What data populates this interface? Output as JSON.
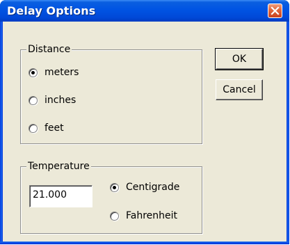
{
  "window": {
    "title": "Delay Options"
  },
  "distance": {
    "legend": "Distance",
    "options": [
      {
        "label": "meters",
        "checked": true
      },
      {
        "label": "inches",
        "checked": false
      },
      {
        "label": "feet",
        "checked": false
      }
    ]
  },
  "temperature": {
    "legend": "Temperature",
    "value": "21.000",
    "options": [
      {
        "label": "Centigrade",
        "checked": true
      },
      {
        "label": "Fahrenheit",
        "checked": false
      }
    ]
  },
  "buttons": {
    "ok_label": "OK",
    "cancel_label": "Cancel"
  },
  "icons": {
    "close": "close-icon"
  },
  "colors": {
    "title_bar": "#0054e3",
    "close_button": "#e26a3e",
    "dialog_bg": "#ece9d8"
  }
}
